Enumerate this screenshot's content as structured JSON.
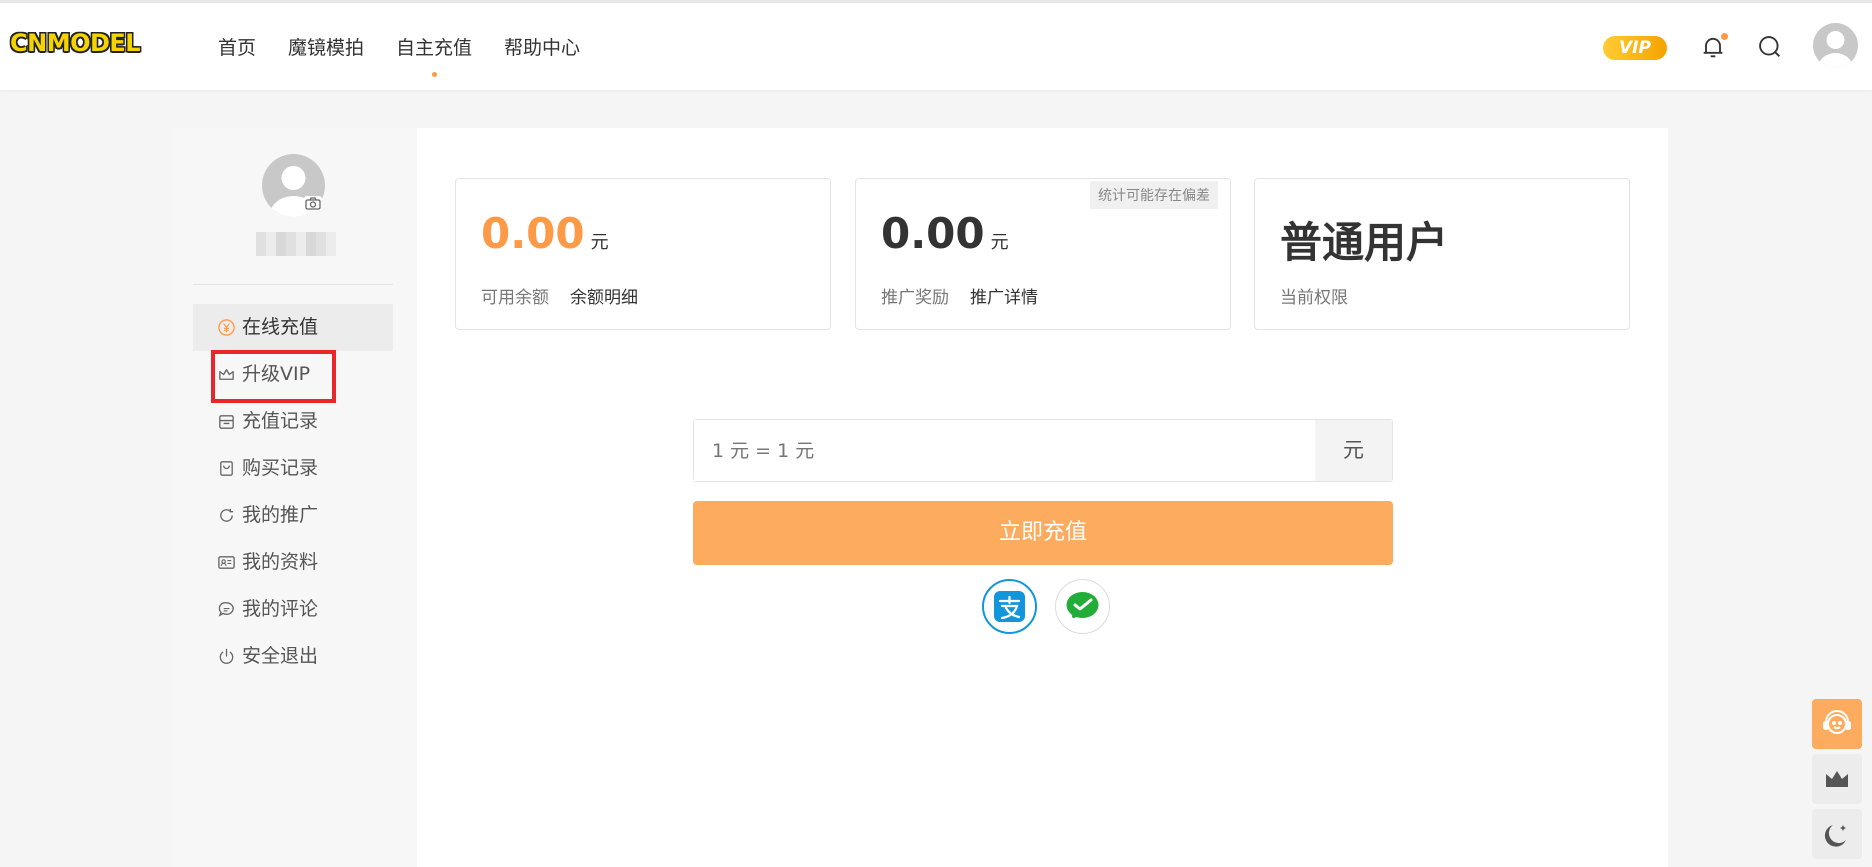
{
  "header": {
    "logo": "CNMODEL",
    "nav": [
      {
        "label": "首页",
        "active": false
      },
      {
        "label": "魔镜模拍",
        "active": false
      },
      {
        "label": "自主充值",
        "active": true
      },
      {
        "label": "帮助中心",
        "active": false
      }
    ],
    "vip_badge": "VIP",
    "icons": [
      "bell-icon",
      "search-icon",
      "avatar"
    ]
  },
  "sidebar": {
    "menu": [
      {
        "label": "在线充值",
        "icon": "yuan-icon",
        "active": true
      },
      {
        "label": "升级VIP",
        "icon": "crown-icon",
        "active": false
      },
      {
        "label": "充值记录",
        "icon": "wallet-icon",
        "active": false
      },
      {
        "label": "购买记录",
        "icon": "bag-icon",
        "active": false
      },
      {
        "label": "我的推广",
        "icon": "share-icon",
        "active": false
      },
      {
        "label": "我的资料",
        "icon": "id-card-icon",
        "active": false
      },
      {
        "label": "我的评论",
        "icon": "comment-icon",
        "active": false
      },
      {
        "label": "安全退出",
        "icon": "power-icon",
        "active": false
      }
    ]
  },
  "cards": {
    "balance": {
      "value": "0.00",
      "unit": "元",
      "label": "可用余额",
      "link": "余额明细"
    },
    "reward": {
      "value": "0.00",
      "unit": "元",
      "label": "推广奖励",
      "link": "推广详情",
      "note": "统计可能存在偏差"
    },
    "level": {
      "value": "普通用户",
      "label": "当前权限"
    }
  },
  "recharge": {
    "placeholder": "1 元 = 1 元",
    "unit": "元",
    "button": "立即充值",
    "methods": [
      "alipay-icon",
      "wechat-pay-icon"
    ]
  },
  "colors": {
    "accent": "#fd9a47",
    "button": "#fdab5e",
    "highlight": "#e8262b"
  }
}
